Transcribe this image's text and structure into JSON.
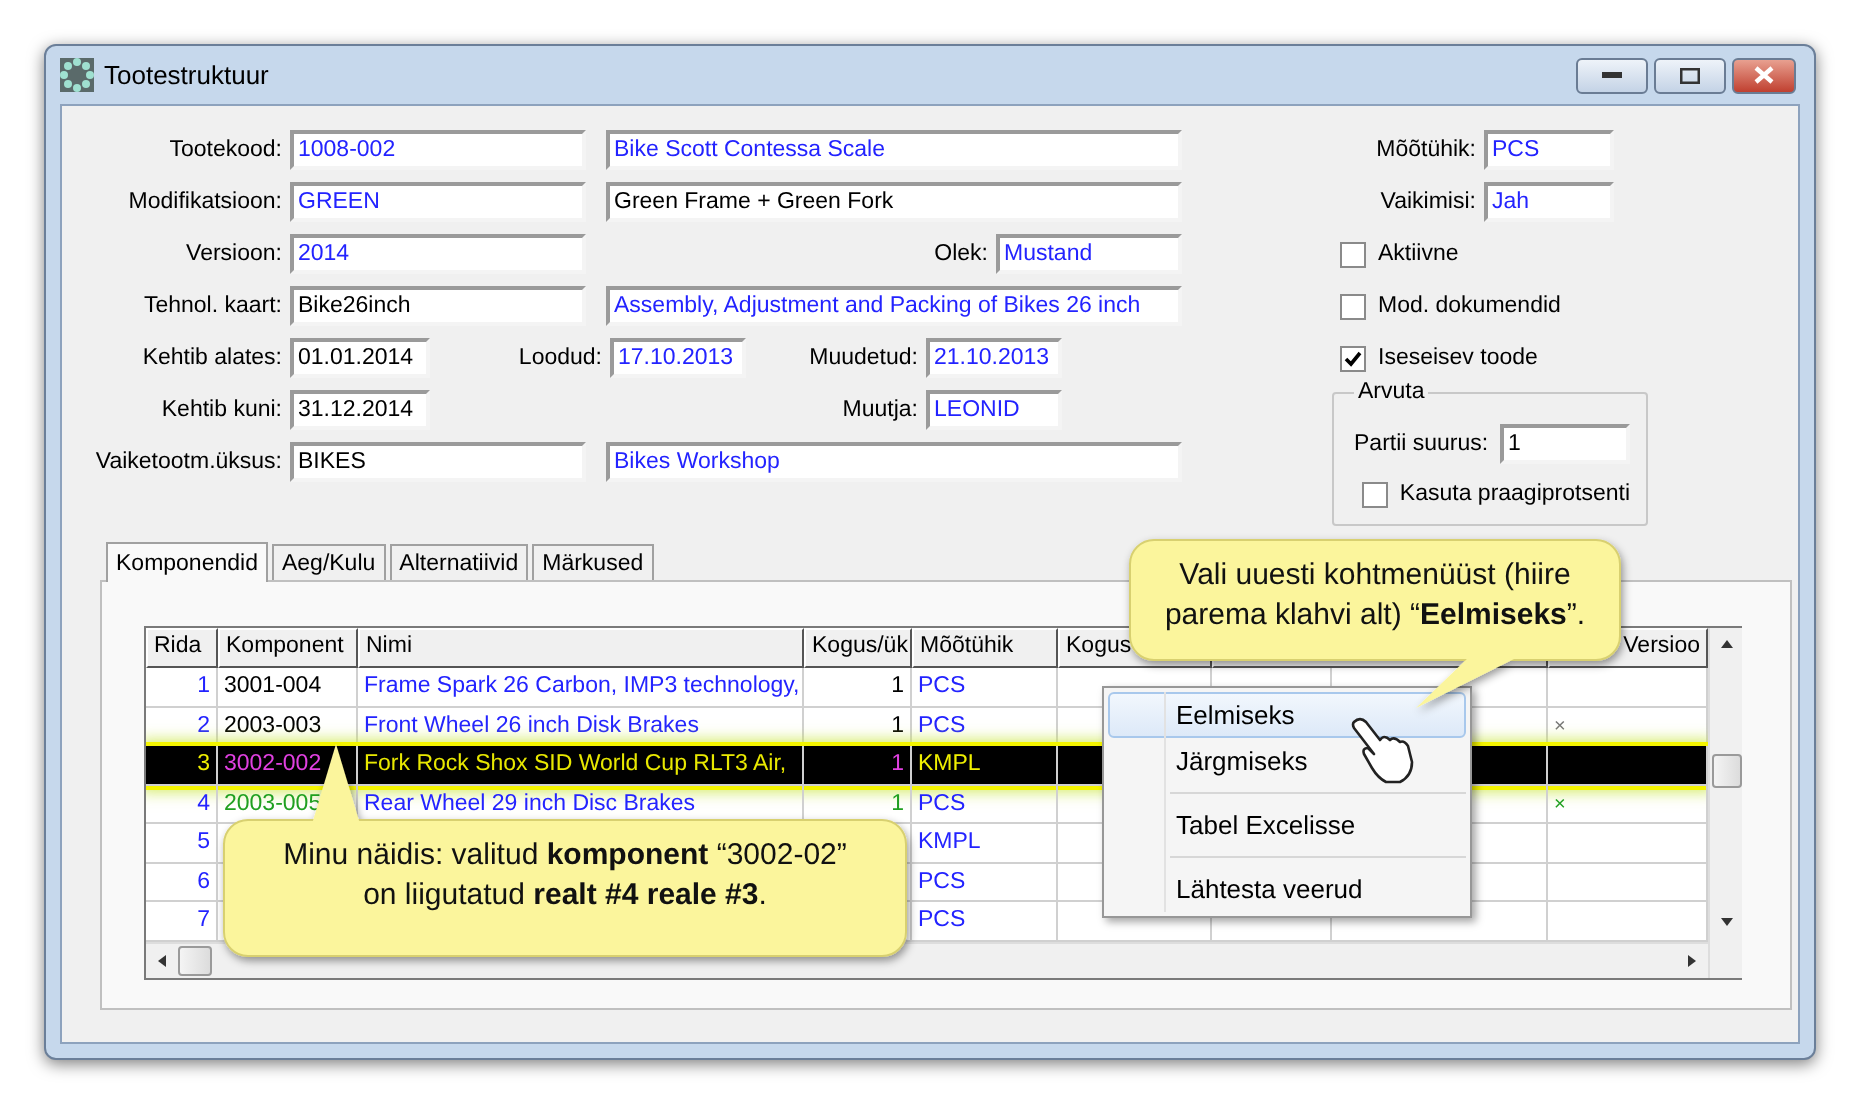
{
  "window": {
    "title": "Tootestruktuur"
  },
  "form": {
    "rows": [
      {
        "kind": "double",
        "label": "Tootekood:",
        "value": {
          "text": "1008-002",
          "link": true
        },
        "description": {
          "text": "Bike Scott Contessa Scale",
          "link": true
        }
      },
      {
        "kind": "double",
        "label": "Modifikatsioon:",
        "value": {
          "text": "GREEN",
          "link": true
        },
        "description": {
          "text": "Green Frame + Green Fork",
          "link": false
        }
      },
      {
        "kind": "side",
        "label": "Versioon:",
        "value": {
          "text": "2014",
          "link": true
        },
        "side_label": "Olek:",
        "side_value": {
          "text": "Mustand",
          "link": true
        }
      },
      {
        "kind": "double",
        "label": "Tehnol. kaart:",
        "value": {
          "text": "Bike26inch",
          "link": false
        },
        "description": {
          "text": "Assembly, Adjustment and Packing of Bikes 26 inch",
          "link": true
        }
      },
      {
        "kind": "dates",
        "label": "Kehtib alates:",
        "value": {
          "text": "01.01.2014",
          "link": false
        },
        "mid_label": "Loodud:",
        "mid_value": {
          "text": "17.10.2013",
          "link": true
        },
        "side_label": "Muudetud:",
        "side_value": {
          "text": "21.10.2013",
          "link": true
        }
      },
      {
        "kind": "short_side",
        "label": "Kehtib kuni:",
        "value": {
          "text": "31.12.2014",
          "link": false
        },
        "side_label": "Muutja:",
        "side_value": {
          "text": "LEONID",
          "link": true
        }
      },
      {
        "kind": "double",
        "label": "Vaiketootm.üksus:",
        "value": {
          "text": "BIKES",
          "link": false
        },
        "description": {
          "text": "Bikes Workshop",
          "link": true
        }
      }
    ],
    "right_fields": [
      {
        "label": "Mõõtühik:",
        "value": {
          "text": "PCS",
          "link": true
        }
      },
      {
        "label": "Vaikimisi:",
        "value": {
          "text": "Jah",
          "link": true
        }
      }
    ],
    "checkboxes": [
      {
        "label": "Aktiivne",
        "checked": false
      },
      {
        "label": "Mod. dokumendid",
        "checked": false
      },
      {
        "label": "Iseseisev toode",
        "checked": true
      }
    ],
    "group": {
      "title": "Arvuta",
      "field_label": "Partii suurus:",
      "field_value": "1",
      "checkbox": {
        "label": "Kasuta praagiprotsenti",
        "checked": false
      }
    }
  },
  "tabs": [
    {
      "label": "Komponendid",
      "selected": true
    },
    {
      "label": "Aeg/Kulu",
      "selected": false
    },
    {
      "label": "Alternatiivid",
      "selected": false
    },
    {
      "label": "Märkused",
      "selected": false
    }
  ],
  "table": {
    "columns": [
      {
        "kind": "plain",
        "label": "Rida"
      },
      {
        "kind": "plain",
        "label": "Komponent"
      },
      {
        "kind": "plain",
        "label": "Nimi"
      },
      {
        "kind": "plain",
        "label": "Kogus/ük"
      },
      {
        "kind": "plain",
        "label": "Mõõtühik"
      },
      {
        "kind": "plain",
        "label": "Kogus"
      },
      {
        "kind": "cut",
        "label": "Versioo"
      }
    ],
    "rows": [
      {
        "kind": "plain",
        "selected": false,
        "rida": "1",
        "komponent": "3001-004",
        "nimi": "Frame Spark 26 Carbon, IMP3 technology,",
        "kogus": "1",
        "unit": "PCS"
      },
      {
        "kind": "plain",
        "selected": false,
        "rida": "2",
        "komponent": "2003-003",
        "nimi": "Front Wheel 26 inch Disk Brakes",
        "kogus": "1",
        "unit": "PCS",
        "mark": "×"
      },
      {
        "kind": "plain",
        "selected": true,
        "rida": "3",
        "komponent": "3002-002",
        "nimi": "Fork Rock Shox SID World Cup RLT3 Air,",
        "kogus": "1",
        "unit": "KMPL"
      },
      {
        "kind": "green",
        "selected": false,
        "rida": "4",
        "komponent": "2003-005",
        "nimi": "Rear Wheel 29 inch Disc Brakes",
        "kogus": "1",
        "unit": "PCS",
        "mark": "×"
      },
      {
        "kind": "plain",
        "selected": false,
        "rida": "5",
        "unit": "KMPL"
      },
      {
        "kind": "plain",
        "selected": false,
        "rida": "6",
        "unit": "PCS"
      },
      {
        "kind": "plain",
        "selected": false,
        "rida": "7",
        "unit": "PCS"
      }
    ]
  },
  "context_menu": {
    "items": [
      {
        "kind": "item",
        "label": "Eelmiseks",
        "selected": true
      },
      {
        "kind": "item",
        "label": "Järgmiseks",
        "selected": false
      },
      {
        "kind": "separator"
      },
      {
        "kind": "item",
        "label": "Tabel Excelisse",
        "selected": false
      },
      {
        "kind": "separator"
      },
      {
        "kind": "item",
        "label": "Lähtesta veerud",
        "selected": false
      }
    ]
  },
  "callouts": [
    {
      "kind": "menu_hint",
      "text": "Vali uuesti kohtmenüüst (hiire parema klahvi alt) “**Eelmiseks**”."
    },
    {
      "kind": "example",
      "text": "Minu näidis: valitud **komponent**  “3002-02” on liigutatud **realt #4 reale #3**."
    }
  ]
}
